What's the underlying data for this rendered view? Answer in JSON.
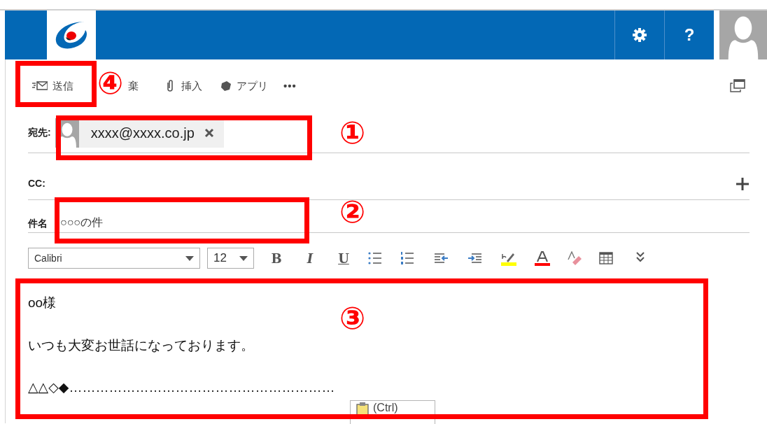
{
  "header": {
    "buttons": [
      {
        "kind": "settings"
      },
      {
        "kind": "help",
        "label": "?"
      }
    ]
  },
  "toolbar": [
    {
      "kind": "send",
      "label": "送信"
    },
    {
      "kind": "discard",
      "label": "棄"
    },
    {
      "kind": "insert",
      "label": "挿入"
    },
    {
      "kind": "apps",
      "label": "アプリ"
    },
    {
      "kind": "more",
      "label": "•••"
    }
  ],
  "to": {
    "label": "宛先:",
    "recipients": [
      {
        "address": "xxxx@xxxx.co.jp"
      }
    ]
  },
  "cc": {
    "label": "CC:"
  },
  "subject": {
    "label": "件名",
    "value": "○○○の件"
  },
  "format": {
    "font": "Calibri",
    "size": "12",
    "tools": [
      {
        "kind": "bold",
        "label": "B"
      },
      {
        "kind": "italic",
        "label": "I"
      },
      {
        "kind": "underline",
        "label": "U"
      },
      {
        "kind": "bullets"
      },
      {
        "kind": "numbering"
      },
      {
        "kind": "outdent"
      },
      {
        "kind": "indent"
      },
      {
        "kind": "highlight"
      },
      {
        "kind": "font-color"
      },
      {
        "kind": "clear"
      },
      {
        "kind": "table"
      },
      {
        "kind": "more"
      }
    ]
  },
  "body": [
    "oo様",
    "いつも大変お世話になっております。",
    "△△◇◆……………………………………………………"
  ],
  "paste": {
    "label": "(Ctrl)"
  },
  "annotations": [
    {
      "label": "④"
    },
    {
      "label": "①"
    },
    {
      "label": "②"
    },
    {
      "label": "③"
    }
  ]
}
